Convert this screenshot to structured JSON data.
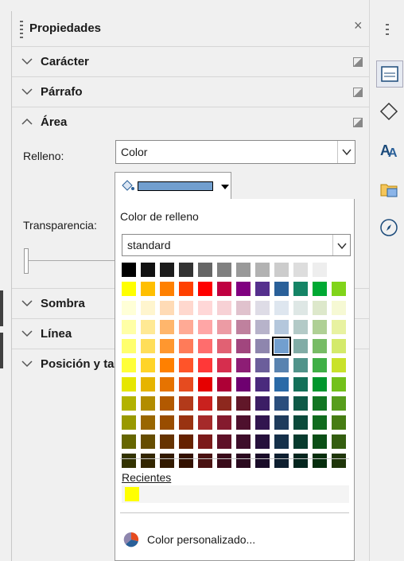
{
  "panel": {
    "title": "Propiedades",
    "close_glyph": "×",
    "sections": {
      "caracter": "Carácter",
      "parrafo": "Párrafo",
      "area": "Área",
      "sombra": "Sombra",
      "linea": "Línea",
      "posicion": "Posición y ta"
    }
  },
  "area": {
    "fill_label": "Relleno:",
    "fill_value": "Color",
    "transparency_label": "Transparencia:",
    "current_fill_color": "#729fcf"
  },
  "popup": {
    "title": "Color de relleno",
    "palette_name": "standard",
    "recent_label": "Recientes",
    "recent_colors": [
      "#ffff00"
    ],
    "custom_label": "Color personalizado...",
    "selected_color": "#729fcf",
    "palette_rows": [
      [
        "#000000",
        "#111111",
        "#1c1c1c",
        "#333333",
        "#666666",
        "#808080",
        "#999999",
        "#b2b2b2",
        "#cccccc",
        "#dddddd",
        "#eeeeee",
        "#ffffff"
      ],
      [
        "#ffff00",
        "#ffbf00",
        "#ff8000",
        "#ff4000",
        "#ff0000",
        "#bf0041",
        "#800080",
        "#55308d",
        "#2a6099",
        "#158466",
        "#00a933",
        "#81d41a"
      ],
      [
        "#ffffd7",
        "#fff5ce",
        "#ffdbb6",
        "#ffd8ce",
        "#ffd7d7",
        "#f7d1d5",
        "#e0c2cd",
        "#dedce6",
        "#dee6ef",
        "#dee7e5",
        "#dde8cb",
        "#f6f9d4"
      ],
      [
        "#ffffa6",
        "#ffe994",
        "#ffb66c",
        "#ffaa95",
        "#ffa6a6",
        "#ec9ba4",
        "#bf819e",
        "#b7b3ca",
        "#b4c7dc",
        "#b3cac7",
        "#afd095",
        "#e8f2a1"
      ],
      [
        "#ffff6d",
        "#ffde59",
        "#ff972f",
        "#ff7b59",
        "#ff6d6d",
        "#e16173",
        "#a1467e",
        "#8e86ae",
        "#729fcf",
        "#81aca6",
        "#77bc65",
        "#d4ea6b"
      ],
      [
        "#ffff38",
        "#ffd428",
        "#ff8000",
        "#ff5429",
        "#ff3838",
        "#d62e4e",
        "#8d1d75",
        "#6b5e9b",
        "#5983b0",
        "#50938a",
        "#3faf46",
        "#c9e22a"
      ],
      [
        "#e6e600",
        "#e6b400",
        "#e67300",
        "#e64b1f",
        "#e60000",
        "#ad0036",
        "#6e0070",
        "#4a2a7d",
        "#2a6aa7",
        "#137059",
        "#00962d",
        "#73c11a"
      ],
      [
        "#b2b200",
        "#b28c00",
        "#b25900",
        "#b23a1a",
        "#c9211e",
        "#8d281e",
        "#611729",
        "#3c1e65",
        "#2a4e7d",
        "#0e5a47",
        "#127622",
        "#579d1c"
      ],
      [
        "#999900",
        "#996600",
        "#994d00",
        "#993311",
        "#a52a2a",
        "#841a2e",
        "#4e102d",
        "#31154f",
        "#1e3b5c",
        "#0b4a3b",
        "#106b1e",
        "#467c13"
      ],
      [
        "#666600",
        "#664d00",
        "#663300",
        "#662200",
        "#7b1a1a",
        "#5e1128",
        "#3e0d2a",
        "#26103c",
        "#15304a",
        "#073b2e",
        "#0b4f16",
        "#345e10"
      ],
      [
        "#333300",
        "#332600",
        "#331a00",
        "#331100",
        "#4a1212",
        "#3a0b1a",
        "#2b0a1f",
        "#1a0c29",
        "#0e1f30",
        "#04261e",
        "#062e0d",
        "#1f360a"
      ]
    ]
  }
}
